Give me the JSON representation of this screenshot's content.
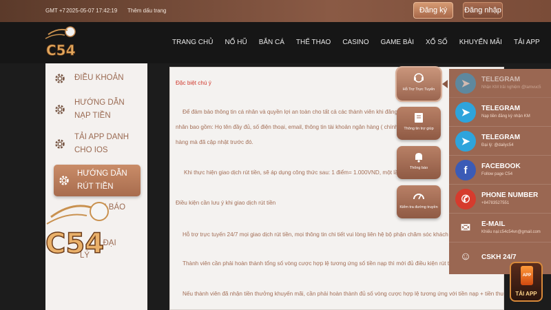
{
  "topbar": {
    "timezone": "GMT +7",
    "datetime": "2025-05-07 17:42:19",
    "bookmark": "Thêm dấu trang",
    "register_label": "Đăng ký",
    "login_label": "Đăng nhập"
  },
  "logo": {
    "text": "C54"
  },
  "nav": {
    "items": [
      "TRANG CHỦ",
      "NỔ HŨ",
      "BẮN CÁ",
      "THỂ THAO",
      "CASINO",
      "GAME BÀI",
      "XỔ SỐ",
      "KHUYẾN MÃI",
      "TẢI APP"
    ]
  },
  "sidebar": {
    "items": [
      {
        "label": "ĐIỀU KHOẢN"
      },
      {
        "label_line1": "HƯỚNG DẪN",
        "label_line2": "NẠP TIỀN"
      },
      {
        "label_line1": "TẢI APP DANH",
        "label_line2": "CHO IOS"
      },
      {
        "label_line1": "HƯỚNG DẪN",
        "label_line2": "RÚT TIỀN"
      },
      {
        "label": "NH BÁO"
      },
      {
        "label": "C ĐẠI"
      },
      {
        "label": "LÝ"
      }
    ]
  },
  "content": {
    "heading": "Đặc biệt chú ý",
    "p1_line1": "Để đảm bảo thông tin cá nhân và quyền lợi an toàn cho tất cả các thành viên khi đăng ký tà",
    "p1_line2": "nhân bao gồm: Họ tên đầy đủ, số điện thoại, email, thông tin tài khoản ngân hàng ( chính chủ",
    "p1_line3": "hàng mà đã cập nhật trước đó.",
    "p2": "Khi thực hiện giao dịch rút tiền, sẽ áp dụng công thức sau: 1 điểm= 1.000VND, một lần gia",
    "conditions_heading": "Điều kiện cần lưu ý khi giao dịch rút tiền",
    "c1": "Hỗ trợ trực tuyến 24/7 mọi giao dịch rút tiền, mọi thông tin chi tiết vui lòng liên hệ bộ phận chăm sóc khách hàng",
    "c2": "Thành viên cần phải hoàn thành tổng số vòng cược hợp lệ tương ứng số tiền nạp thì mới đủ điều kiện rút tiền",
    "c3": "Nếu thành viên đã nhận tiền thưởng khuyến mãi, cần phải hoàn thành đủ số vòng cược hợp lệ tương ứng với tiền nạp + tiền thưởng từ"
  },
  "support": {
    "buttons": [
      {
        "label": "Hỗ Trợ Trực Tuyến",
        "icon": "headset-icon"
      },
      {
        "label": "Thông tin trợ giúp",
        "icon": "book-icon"
      },
      {
        "label": "Thông báo",
        "icon": "bell-icon"
      },
      {
        "label": "Kiểm tra đường truyền",
        "icon": "speedometer-icon"
      }
    ]
  },
  "contacts": [
    {
      "title": "TELEGRAM",
      "subtitle": "Nhận KM trải nghiệm @lamvuc5",
      "icon": "telegram-icon"
    },
    {
      "title": "TELEGRAM",
      "subtitle": "Nạp tiền đăng ký nhận KM",
      "icon": "telegram-icon"
    },
    {
      "title": "TELEGRAM",
      "subtitle": "Đại lý: @dailyc54",
      "icon": "telegram-icon"
    },
    {
      "title": "FACEBOOK",
      "subtitle": "Follow page C54",
      "icon": "facebook-icon"
    },
    {
      "title": "PHONE NUMBER",
      "subtitle": "+84783527551",
      "icon": "phone-icon"
    },
    {
      "title": "E-MAIL",
      "subtitle": "Khiếu nại:c54c54vn@gmail.com",
      "icon": "mail-icon"
    },
    {
      "title": "CSKH 24/7",
      "subtitle": "",
      "icon": "agent-icon"
    }
  ],
  "tai_app": {
    "phone_text": "APP",
    "label": "TẢI APP"
  },
  "colors": {
    "accent": "#a86c4e",
    "topbar": "#8a5a45",
    "header_bg": "#161616",
    "content_text": "#a26d55",
    "heading_red": "#d0372b",
    "telegram": "#2ea4dc",
    "facebook": "#3b5bb6",
    "phone": "#d63b2d"
  }
}
